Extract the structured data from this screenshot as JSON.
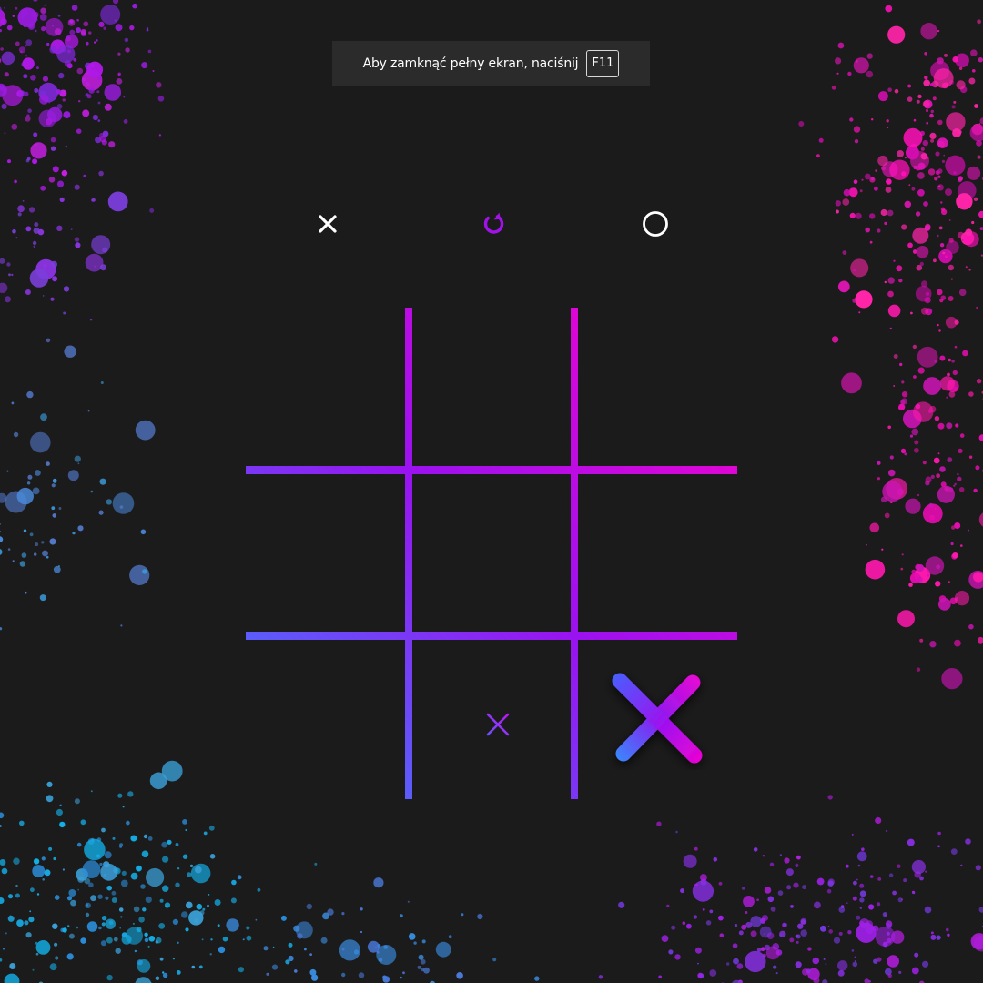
{
  "notice": {
    "text": "Aby zamknąć pełny ekran, naciśnij",
    "key": "F11"
  },
  "controls": {
    "player_x_icon": "close-x-icon",
    "reset_icon": "rotate-cw-icon",
    "player_o_icon": "circle-icon"
  },
  "colors": {
    "background": "#1c1b1c",
    "gradient_start": "#3b7bff",
    "gradient_mid": "#9a12f0",
    "gradient_end": "#ff00c8",
    "reset_accent": "#a112e8",
    "control_icon": "#ffffff"
  },
  "board": {
    "cells": [
      {
        "row": 0,
        "col": 0,
        "mark": ""
      },
      {
        "row": 0,
        "col": 1,
        "mark": ""
      },
      {
        "row": 0,
        "col": 2,
        "mark": ""
      },
      {
        "row": 1,
        "col": 0,
        "mark": ""
      },
      {
        "row": 1,
        "col": 1,
        "mark": ""
      },
      {
        "row": 1,
        "col": 2,
        "mark": ""
      },
      {
        "row": 2,
        "col": 0,
        "mark": ""
      },
      {
        "row": 2,
        "col": 1,
        "mark": "x-hover"
      },
      {
        "row": 2,
        "col": 2,
        "mark": "x"
      }
    ]
  }
}
